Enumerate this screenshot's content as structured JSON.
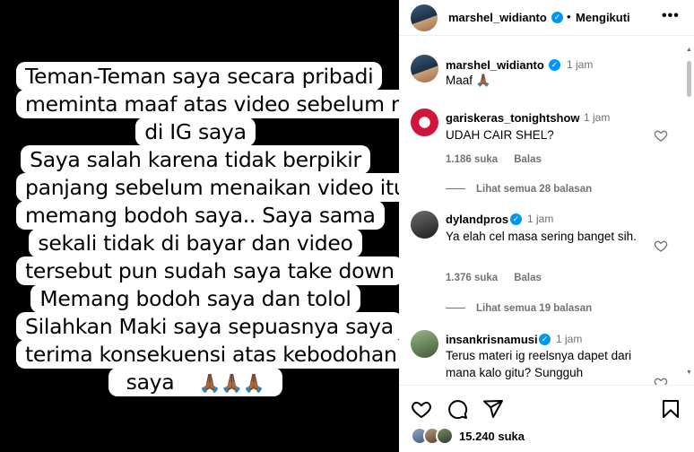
{
  "media": {
    "statement_lines": [
      "Teman-Teman saya secara pribadi",
      "meminta maaf atas video sebelum nya",
      "di IG saya",
      "Saya salah karena tidak berpikir",
      "panjang sebelum menaikan video itu",
      "memang bodoh saya.. Saya sama",
      "sekali tidak di bayar dan video",
      "tersebut pun sudah saya take down",
      "Memang bodoh saya dan tolol",
      "Silahkan Maki saya sepuasnya saya",
      "terima konsekuensi atas kebodohan",
      "saya"
    ],
    "statement_emoji": "🙏🏾🙏🏾🙏🏾"
  },
  "header": {
    "username": "marshel_widianto",
    "separator": "•",
    "follow_label": "Mengikuti",
    "more_label": "•••"
  },
  "caption": {
    "username": "marshel_widianto",
    "time": "1 jam",
    "text": "Maaf 🙏🏾"
  },
  "comments": [
    {
      "username": "gariskeras_tonightshow",
      "time": "1 jam",
      "text": "UDAH CAIR SHEL?",
      "likes": "1.186 suka",
      "reply_label": "Balas",
      "view_replies": "Lihat semua 28 balasan"
    },
    {
      "username": "dylandpros",
      "verified": true,
      "time": "1 jam",
      "text": "Ya elah cel masa sering banget sih.",
      "likes": "1.376 suka",
      "reply_label": "Balas",
      "view_replies": "Lihat semua 19 balasan"
    },
    {
      "username": "insankrisnamusi",
      "verified": true,
      "time": "1 jam",
      "text": "Terus materi ig reelsnya dapet dari mana kalo gitu? Sungguh"
    }
  ],
  "actions": {
    "like_count": "15.240 suka",
    "icons": [
      "heart-icon",
      "comment-icon",
      "share-icon",
      "bookmark-icon"
    ]
  },
  "colors": {
    "verified": "#0095f6",
    "muted_text": "#737373",
    "media_background": "#000000"
  }
}
